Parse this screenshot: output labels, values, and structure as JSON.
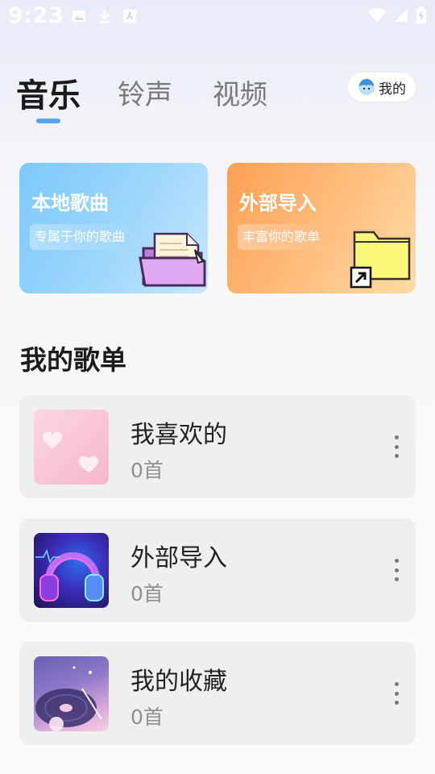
{
  "status_bar": {
    "time": "9:23"
  },
  "tabs": [
    {
      "label": "音乐",
      "active": true
    },
    {
      "label": "铃声",
      "active": false
    },
    {
      "label": "视频",
      "active": false
    }
  ],
  "mine_button": {
    "label": "我的"
  },
  "cards": {
    "local": {
      "title": "本地歌曲",
      "subtitle": "专属于你的歌曲"
    },
    "import": {
      "title": "外部导入",
      "subtitle": "丰富你的歌单"
    }
  },
  "section": {
    "title": "我的歌单"
  },
  "playlists": [
    {
      "name": "我喜欢的",
      "count": "0首"
    },
    {
      "name": "外部导入",
      "count": "0首"
    },
    {
      "name": "我的收藏",
      "count": "0首"
    }
  ],
  "colors": {
    "accent": "#5aa6ee",
    "local_card": "#7cc9fb",
    "import_card": "#ff9f54"
  }
}
